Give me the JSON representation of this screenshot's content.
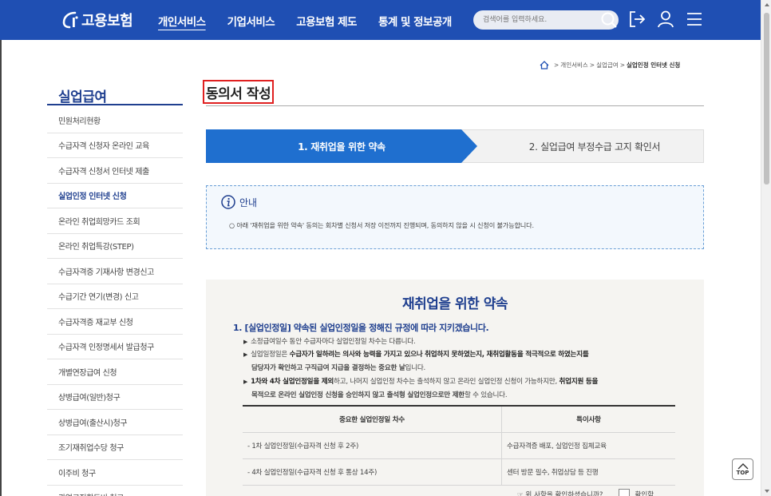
{
  "header": {
    "logo_text": "고용보험",
    "nav": [
      {
        "label": "개인서비스",
        "active": true
      },
      {
        "label": "기업서비스",
        "active": false
      },
      {
        "label": "고용보험 제도",
        "active": false
      },
      {
        "label": "통계 및 정보공개",
        "active": false
      }
    ],
    "search_placeholder": "검색어를 입력하세요."
  },
  "breadcrumb": {
    "items": [
      "개인서비스",
      "실업급여"
    ],
    "current": "실업인정 인터넷 신청",
    "separator": ">"
  },
  "sidebar": {
    "title": "실업급여",
    "items": [
      {
        "label": "민원처리현황",
        "active": false
      },
      {
        "label": "수급자격 신청자 온라인 교육",
        "active": false
      },
      {
        "label": "수급자격 신청서 인터넷 제출",
        "active": false
      },
      {
        "label": "실업인정 인터넷 신청",
        "active": true
      },
      {
        "label": "온라인 취업희망카드 조회",
        "active": false
      },
      {
        "label": "온라인 취업특강(STEP)",
        "active": false
      },
      {
        "label": "수급자격증 기재사항 변경신고",
        "active": false
      },
      {
        "label": "수급기간 연기(변경) 신고",
        "active": false
      },
      {
        "label": "수급자격증 재교부 신청",
        "active": false
      },
      {
        "label": "수급자격 인정명세서 발급청구",
        "active": false
      },
      {
        "label": "개별연장급여 신청",
        "active": false
      },
      {
        "label": "상병급여(일반)청구",
        "active": false
      },
      {
        "label": "상병급여(출산시)청구",
        "active": false
      },
      {
        "label": "조기재취업수당 청구",
        "active": false
      },
      {
        "label": "이주비 청구",
        "active": false
      },
      {
        "label": "광역구직활동비 청구",
        "active": false
      }
    ]
  },
  "main": {
    "title": "동의서 작성",
    "steps": [
      {
        "label": "1. 재취업을 위한 약속",
        "active": true
      },
      {
        "label": "2. 실업급여 부정수급 고지 확인서",
        "active": false
      }
    ],
    "notice": {
      "label": "안내",
      "text": "○ 아래 '재취업을 위한 약속' 동의는 회차별 신청서 저장 이전까지 진행되며, 동의하지 않을 시 신청이 불가능합니다."
    },
    "pledge": {
      "title": "재취업을 위한 약속",
      "heading": "1. [실업인정일] 약속된 실업인정일을 정해진 규정에 따라 지키겠습니다.",
      "bullets": [
        {
          "parts": [
            {
              "t": "소정급여일수 동안 수급자마다 실업인정일 차수는 다릅니다.",
              "b": false
            }
          ]
        },
        {
          "parts": [
            {
              "t": "실업일정일은 ",
              "b": false
            },
            {
              "t": "수급자가 일하려는 의사와 능력을 가지고 있으나 취업하지 못하였는지, 재취업활동을 적극적으로 하였는지를",
              "b": true
            }
          ],
          "cont": [
            {
              "t": "담당자가 확인하고 구직급여 지급을 결정하는 중요한 날",
              "b": true
            },
            {
              "t": "입니다.",
              "b": false
            }
          ]
        },
        {
          "parts": [
            {
              "t": "1차와 4차 실업인정일을 제외",
              "b": true
            },
            {
              "t": "하고, 나머지 실업인정 차수는 출석하지 않고 온라인 실업인정 신청이 가능하지만, ",
              "b": false
            },
            {
              "t": "취업지원 등을",
              "b": true
            }
          ],
          "cont": [
            {
              "t": "목적으로 온라인 실업인정 신청을 승인하지 않고 출석형 실업인정으로만 제한",
              "b": true
            },
            {
              "t": "할 수 있습니다.",
              "b": false
            }
          ]
        }
      ],
      "table": {
        "headers": [
          "중요한 실업인정일 차수",
          "특이사항"
        ],
        "rows": [
          [
            "- 1차 실업인정일(수급자격 신청 후 2주)",
            "수급자격증 배포, 실업인정 집체교육"
          ],
          [
            "- 4차 실업인정일(수급자격 신청 후 통상 14주)",
            "센터 방문 필수, 취업상담 등 진행"
          ]
        ]
      },
      "confirm_question": "☞ 위 사항을 확인하셨습니까?",
      "confirm_label": "확인함"
    }
  },
  "top_button_label": "TOP",
  "colors": {
    "brand_blue": "#1f4fb3",
    "step_active": "#1f6fcf",
    "title_border": "#e02020",
    "sidebar_accent": "#1f3f8f"
  }
}
